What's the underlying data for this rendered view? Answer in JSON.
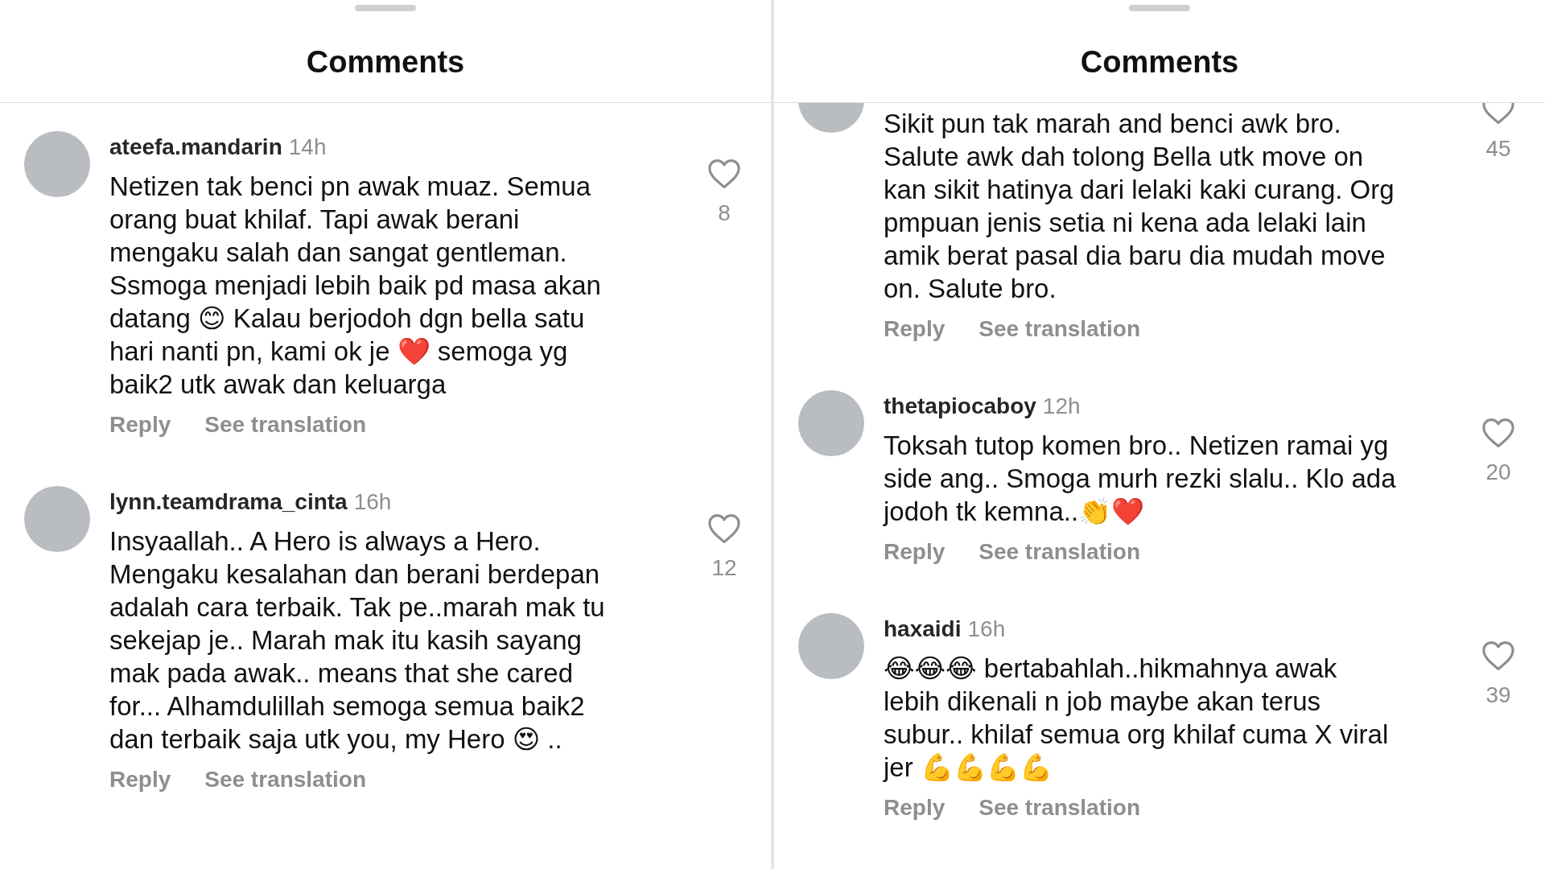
{
  "panels": [
    {
      "title": "Comments",
      "comments": [
        {
          "username": "ateefa.mandarin",
          "time": "14h",
          "text": "Netizen tak benci pn awak muaz. Semua orang buat khilaf. Tapi awak berani mengaku salah dan sangat gentleman. Ssmoga menjadi lebih baik pd masa akan datang 😊 Kalau berjodoh dgn bella satu hari nanti pn, kami ok je ❤️ semoga yg baik2 utk awak dan keluarga",
          "likes": "8",
          "liked": false,
          "actions": [
            "Reply",
            "See translation"
          ]
        },
        {
          "username": "lynn.teamdrama_cinta",
          "time": "16h",
          "text": "Insyaallah.. A Hero is always a Hero. Mengaku kesalahan dan berani berdepan adalah cara terbaik. Tak pe..marah mak tu sekejap je.. Marah mak itu kasih sayang mak pada awak.. means that she cared for... Alhamdulillah semoga semua baik2 dan terbaik saja utk you, my Hero 😍 ..",
          "likes": "12",
          "liked": false,
          "actions": [
            "Reply",
            "See translation"
          ]
        }
      ]
    },
    {
      "title": "Comments",
      "comments": [
        {
          "text": "Sikit pun tak marah and benci awk bro. Salute awk dah tolong Bella utk move on kan sikit hatinya dari lelaki kaki curang. Org pmpuan jenis setia ni kena ada lelaki lain amik berat pasal dia baru dia mudah move on. Salute bro.",
          "likes": "45",
          "liked": false,
          "actions": [
            "Reply",
            "See translation"
          ]
        },
        {
          "username": "thetapiocaboy",
          "time": "12h",
          "text": "Toksah tutop komen bro.. Netizen ramai yg side ang.. Smoga murh rezki slalu.. Klo ada jodoh tk kemna..👏❤️",
          "likes": "20",
          "liked": false,
          "actions": [
            "Reply",
            "See translation"
          ]
        },
        {
          "username": "haxaidi",
          "time": "16h",
          "text": "😂😂😂 bertabahlah..hikmahnya awak lebih dikenali n job maybe akan terus subur.. khilaf semua org khilaf cuma X viral jer 💪💪💪💪",
          "likes": "39",
          "liked": false,
          "actions": [
            "Reply",
            "See translation"
          ]
        }
      ]
    }
  ]
}
